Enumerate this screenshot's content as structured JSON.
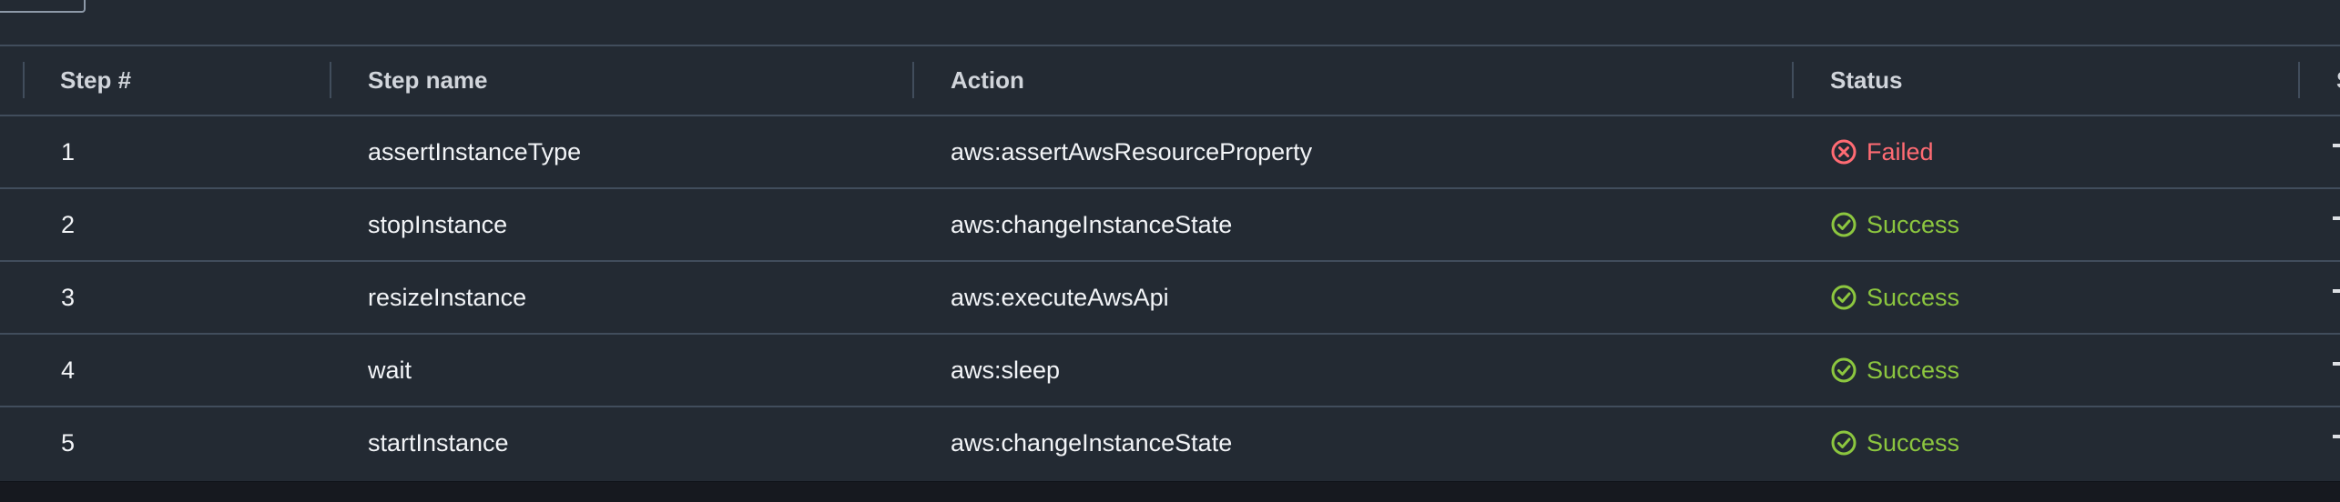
{
  "table": {
    "headers": {
      "step_number": "Step #",
      "step_name": "Step name",
      "action": "Action",
      "status": "Status",
      "cut_off_next": "S"
    },
    "rows": [
      {
        "step_number": "1",
        "step_name": "assertInstanceType",
        "action": "aws:assertAwsResourceProperty",
        "status": "Failed",
        "status_icon": "failed-icon"
      },
      {
        "step_number": "2",
        "step_name": "stopInstance",
        "action": "aws:changeInstanceState",
        "status": "Success",
        "status_icon": "success-icon"
      },
      {
        "step_number": "3",
        "step_name": "resizeInstance",
        "action": "aws:executeAwsApi",
        "status": "Success",
        "status_icon": "success-icon"
      },
      {
        "step_number": "4",
        "step_name": "wait",
        "action": "aws:sleep",
        "status": "Success",
        "status_icon": "success-icon"
      },
      {
        "step_number": "5",
        "step_name": "startInstance",
        "action": "aws:changeInstanceState",
        "status": "Success",
        "status_icon": "success-icon"
      }
    ]
  },
  "colors": {
    "page_background": "#16191f",
    "table_background": "#232a33",
    "divider": "#414d5c",
    "header_text": "#d1d5db",
    "body_text": "#f2f4f7",
    "failed": "#ff6b73",
    "success": "#8cc63f"
  }
}
